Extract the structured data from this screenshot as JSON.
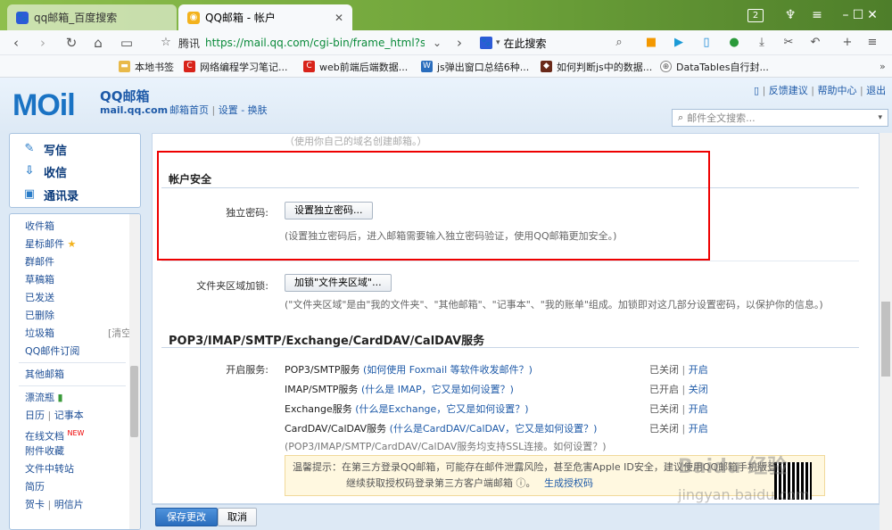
{
  "browser": {
    "tabs": [
      {
        "title": "qq邮箱_百度搜索",
        "active": false
      },
      {
        "title": "QQ邮箱 - 帐户",
        "active": true
      }
    ],
    "window_badge": "2",
    "url_prefix": "腾讯",
    "url": "https://mail.qq.com/cgi-bin/frame_html?s",
    "search_placeholder": "在此搜索",
    "bookmarks": [
      "本地书签",
      "网络编程学习笔记...",
      "web前端后端数据...",
      "js弹出窗口总结6种...",
      "如何判断js中的数据...",
      "DataTables自行封..."
    ]
  },
  "header": {
    "logo_text": "MOil",
    "logo_title": "QQ邮箱",
    "logo_domain": "mail.qq.com",
    "nav_home": "邮箱首页",
    "nav_sep": "|",
    "nav_settings": "设置",
    "nav_skin": "换肤",
    "top_feedback": "反馈建议",
    "top_help": "帮助中心",
    "top_logout": "退出",
    "mail_search_placeholder": "邮件全文搜索..."
  },
  "sidebar": {
    "compose": "写信",
    "inbox_check": "收信",
    "contacts": "通讯录",
    "folders": [
      "收件箱",
      "星标邮件",
      "群邮件",
      "草稿箱",
      "已发送",
      "已删除",
      "垃圾箱",
      "QQ邮件订阅"
    ],
    "junk_clear": "[清空]",
    "other_mailbox": "其他邮箱",
    "apps": [
      "漂流瓶",
      "日历",
      "记事本",
      "在线文档",
      "附件收藏",
      "文件中转站",
      "简历",
      "贺卡",
      "明信片"
    ],
    "new_badge": "NEW"
  },
  "main": {
    "top_cut_text": "（使用你自己的域名创建邮箱。）",
    "account_security_title": "帐户安全",
    "independent_pwd_label": "独立密码:",
    "independent_pwd_button": "设置独立密码...",
    "independent_pwd_hint": "(设置独立密码后，进入邮箱需要输入独立密码验证，使用QQ邮箱更加安全。)",
    "folder_lock_label": "文件夹区域加锁:",
    "folder_lock_button": "加锁\"文件夹区域\"...",
    "folder_lock_hint": "(\"文件夹区域\"是由\"我的文件夹\"、\"其他邮箱\"、\"记事本\"、\"我的账单\"组成。加锁即对这几部分设置密码，以保护你的信息。)",
    "services_title": "POP3/IMAP/SMTP/Exchange/CardDAV/CalDAV服务",
    "open_service_label": "开启服务:",
    "services": [
      {
        "name": "POP3/SMTP服务",
        "link": "(如何使用 Foxmail 等软件收发邮件？)",
        "state": "已关闭",
        "action": "开启"
      },
      {
        "name": "IMAP/SMTP服务",
        "link": "(什么是 IMAP，它又是如何设置？)",
        "state": "已开启",
        "action": "关闭"
      },
      {
        "name": "Exchange服务",
        "link": "(什么是Exchange，它又是如何设置？)",
        "state": "已关闭",
        "action": "开启"
      },
      {
        "name": "CardDAV/CalDAV服务",
        "link": "(什么是CardDAV/CalDAV，它又是如何设置？)",
        "state": "已关闭",
        "action": "开启"
      }
    ],
    "ssl_note": "(POP3/IMAP/SMTP/CardDAV/CalDAV服务均支持SSL连接。如何设置？)",
    "warning_line1": "温馨提示：在第三方登录QQ邮箱，可能存在邮件泄露风险，甚至危害Apple ID安全，建议使用QQ邮箱手机版登录。",
    "warning_line2": "继续获取授权码登录第三方客户端邮箱 ⓘ。",
    "warning_link": "生成授权码"
  },
  "footer": {
    "save": "保存更改",
    "cancel": "取消"
  },
  "watermark": {
    "line1": "Baidu 经验",
    "line2": "jingyan.baidu.com"
  }
}
